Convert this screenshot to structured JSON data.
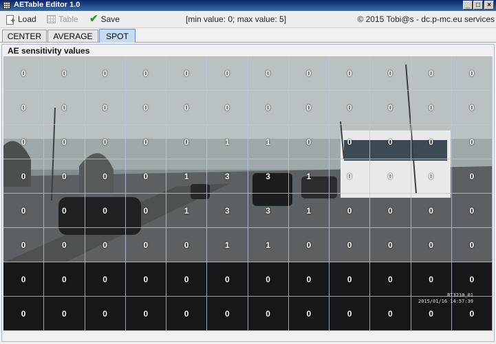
{
  "window": {
    "title": "AETable Editor 1.0",
    "controls": [
      "_",
      "□",
      "×"
    ]
  },
  "toolbar": {
    "load_label": "Load",
    "table_label": "Table",
    "save_label": "Save",
    "info": "[min value: 0; max value: 5]",
    "copyright": "© 2015 Tobi@s - dc.p-mc.eu services"
  },
  "tabs": [
    {
      "label": "CENTER",
      "active": false
    },
    {
      "label": "AVERAGE",
      "active": false
    },
    {
      "label": "SPOT",
      "active": true
    }
  ],
  "panel": {
    "title": "AE sensitivity values"
  },
  "grid": {
    "rows": [
      [
        "0",
        "0",
        "0",
        "0",
        "0",
        "0",
        "0",
        "0",
        "0",
        "0",
        "0",
        "0"
      ],
      [
        "0",
        "0",
        "0",
        "0",
        "0",
        "0",
        "0",
        "0",
        "0",
        "0",
        "0",
        "0"
      ],
      [
        "0",
        "0",
        "0",
        "0",
        "0",
        "1",
        "1",
        "0",
        "0",
        "0",
        "0",
        "0"
      ],
      [
        "0",
        "0",
        "0",
        "0",
        "1",
        "3",
        "3",
        "1",
        "0",
        "0",
        "0",
        "0"
      ],
      [
        "0",
        "0",
        "0",
        "0",
        "1",
        "3",
        "3",
        "1",
        "0",
        "0",
        "0",
        "0"
      ],
      [
        "0",
        "0",
        "0",
        "0",
        "0",
        "1",
        "1",
        "0",
        "0",
        "0",
        "0",
        "0"
      ],
      [
        "0",
        "0",
        "0",
        "0",
        "0",
        "0",
        "0",
        "0",
        "0",
        "0",
        "0",
        "0"
      ],
      [
        "0",
        "0",
        "0",
        "0",
        "0",
        "0",
        "0",
        "0",
        "0",
        "0",
        "0",
        "0"
      ]
    ]
  },
  "overlay": {
    "camera_label": "RT3210_01",
    "timestamp": "2015/01/16 14:57:39"
  }
}
